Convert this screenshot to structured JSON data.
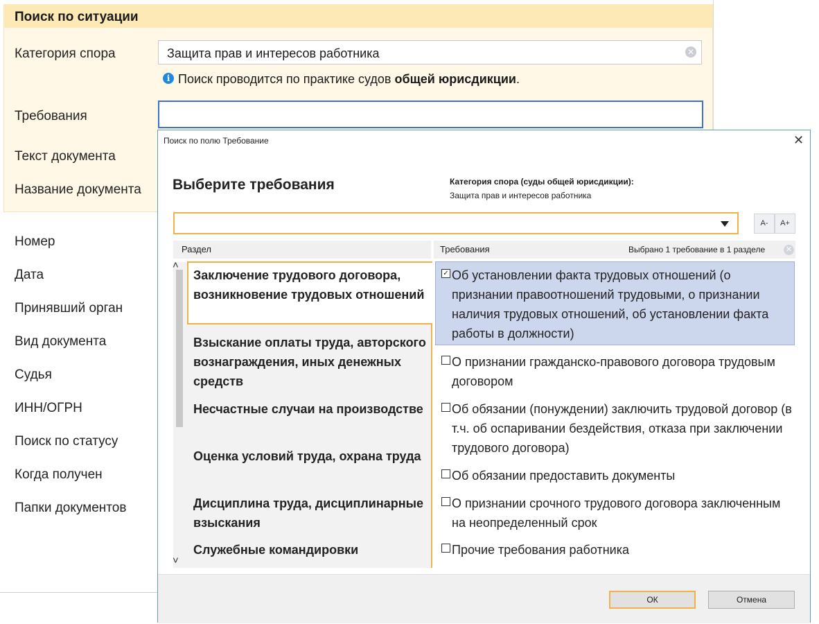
{
  "form": {
    "title": "Поиск по ситуации",
    "category_label": "Категория спора",
    "category_value": "Защита прав и интересов работника",
    "info_prefix": "Поиск проводится по практике судов ",
    "info_bold": "общей юрисдикции",
    "info_suffix": ".",
    "fields": [
      "Требования",
      "Текст документа",
      "Название документа",
      "Номер",
      "Дата",
      "Принявший орган",
      "Вид документа",
      "Судья",
      "ИНН/ОГРН",
      "Поиск по статусу",
      "Когда получен",
      "Папки документов"
    ]
  },
  "dialog": {
    "title": "Поиск по полю Требование",
    "close": "✕",
    "heading": "Выберите требования",
    "category_caption": "Категория спора (суды общей юрисдикции):",
    "category_value": "Защита прав и интересов работника",
    "font_minus": "A-",
    "font_plus": "A+",
    "col_section": "Раздел",
    "col_requirements": "Требования",
    "selected_info": "Выбрано 1 требование в 1 разделе",
    "sections": [
      "Заключение трудового договора, возникновение трудовых отношений",
      "Взыскание оплаты труда, авторского вознаграждения, иных денежных средств",
      "Несчастные случаи на производстве",
      "Оценка условий труда, охрана труда",
      "Дисциплина труда, дисциплинарные взыскания",
      "Служебные командировки"
    ],
    "requirements": [
      {
        "text": "Об установлении факта трудовых отношений (о признании правоотношений трудовыми, о признании наличия трудовых отношений, об установлении факта работы в должности)",
        "checked": true
      },
      {
        "text": "О признании гражданско-правового договора трудовым договором",
        "checked": false
      },
      {
        "text": "Об обязании (понуждении) заключить трудовой договор (в т.ч. об оспаривании бездействия, отказа при заключении трудового договора)",
        "checked": false
      },
      {
        "text": "Об обязании предоставить документы",
        "checked": false
      },
      {
        "text": "О признании срочного трудового договора заключенным на неопределенный срок",
        "checked": false
      },
      {
        "text": "Прочие требования работника",
        "checked": false
      }
    ],
    "ok": "ОК",
    "cancel": "Отмена"
  }
}
